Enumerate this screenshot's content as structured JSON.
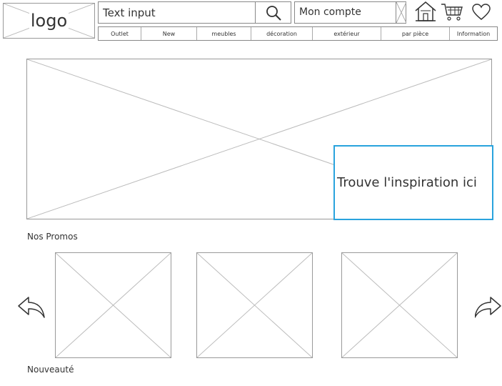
{
  "header": {
    "logo_text": "logo",
    "search_value": "Text input",
    "search_icon": "search-icon",
    "account_label": "Mon compte",
    "icons": [
      "home-icon",
      "cart-icon",
      "heart-icon"
    ]
  },
  "nav": {
    "items": [
      "Outlet",
      "New",
      "meubles",
      "décoration",
      "extérieur",
      "par pièce",
      "Information"
    ]
  },
  "hero": {
    "callout": "Trouve l'inspiration ici",
    "accent_color": "#29a3dd"
  },
  "promos": {
    "title": "Nos Promos",
    "prev_icon": "arrow-left-icon",
    "next_icon": "arrow-right-icon"
  },
  "nouveaute": {
    "title": "Nouveauté"
  }
}
